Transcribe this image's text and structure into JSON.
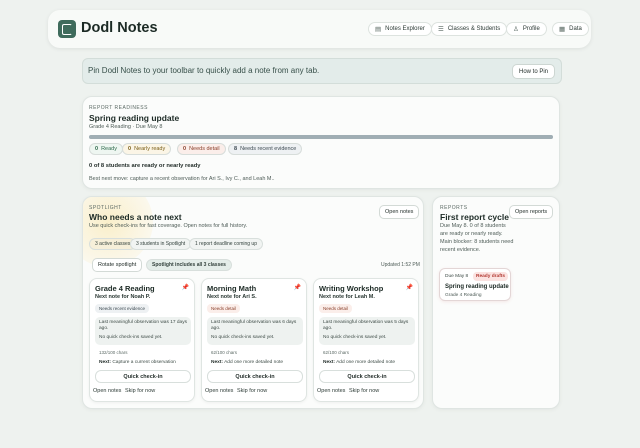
{
  "app": {
    "brand": "Dodl Notes",
    "nav": [
      {
        "label": "Notes Explorer",
        "icon": "note-icon"
      },
      {
        "label": "Classes & Students",
        "icon": "list-icon"
      },
      {
        "label": "Profile",
        "icon": "person-icon"
      },
      {
        "label": "Data",
        "icon": "database-icon"
      }
    ]
  },
  "pin_banner": {
    "text": "Pin Dodl Notes to your toolbar to quickly add a note from any tab.",
    "button": "How to Pin"
  },
  "readiness": {
    "kicker": "REPORT READINESS",
    "title": "Spring reading update",
    "subtitle": "Grade 4 Reading · Due May 8",
    "progress": 0,
    "pills": [
      {
        "count": "0",
        "label": "Ready",
        "bg": "#eef6f1",
        "color": "#2f6b4c"
      },
      {
        "count": "0",
        "label": "Nearly ready",
        "bg": "#fbf5e6",
        "color": "#7a5e17"
      },
      {
        "count": "0",
        "label": "Needs detail",
        "bg": "#fbeeea",
        "color": "#8a3f2a"
      },
      {
        "count": "8",
        "label": "Needs recent evidence",
        "bg": "#eef1f3",
        "color": "#3d4a52"
      }
    ],
    "summary": "0 of 8 students are ready or nearly ready",
    "next_move": "Best next move: capture a recent observation for Ari S., Ivy C., and Leah M.."
  },
  "spotlight": {
    "kicker": "SPOTLIGHT",
    "title": "Who needs a note next",
    "subtitle": "Use quick check-ins for fast coverage. Open notes for full history.",
    "open_notes": "Open notes",
    "chips": [
      "3 active classes",
      "3 students in Spotlight",
      "1 report deadline coming up"
    ],
    "rotate": "Rotate spotlight",
    "includes": "Spotlight includes all 3 classes",
    "updated": "Updated 1:52 PM",
    "classes": [
      {
        "title": "Grade 4 Reading",
        "next_note": "Next note for Noah P.",
        "tag": "Needs recent evidence",
        "tag_bg": "#eef1f3",
        "tag_color": "#3d4a52",
        "observation": "Last meaningful observation was 17 days ago.",
        "checkins": "No quick check-ins saved yet.",
        "chars": "132/100 chars",
        "next_label": "Next:",
        "next_text": "Capture a current observation",
        "quick": "Quick check-in",
        "open": "Open notes",
        "skip": "Skip for now"
      },
      {
        "title": "Morning Math",
        "next_note": "Next note for Ari S.",
        "tag": "Needs detail",
        "tag_bg": "#fbeeea",
        "tag_color": "#8a3f2a",
        "observation": "Last meaningful observation was 6 days ago.",
        "checkins": "No quick check-ins saved yet.",
        "chars": "62/100 chars",
        "next_label": "Next:",
        "next_text": "Add one more detailed note",
        "quick": "Quick check-in",
        "open": "Open notes",
        "skip": "Skip for now"
      },
      {
        "title": "Writing Workshop",
        "next_note": "Next note for Leah M.",
        "tag": "Needs detail",
        "tag_bg": "#fbeeea",
        "tag_color": "#8a3f2a",
        "observation": "Last meaningful observation was 5 days ago.",
        "checkins": "No quick check-ins saved yet.",
        "chars": "62/100 chars",
        "next_label": "Next:",
        "next_text": "Add one more detailed note",
        "quick": "Quick check-in",
        "open": "Open notes",
        "skip": "Skip for now"
      }
    ]
  },
  "reports": {
    "kicker": "REPORTS",
    "title": "First report cycle",
    "open": "Open reports",
    "desc": "Due May 8. 0 of 8 students are ready or nearly ready. Main blocker: 8 students need recent evidence.",
    "card": {
      "due": "Due May 8",
      "badge": "Ready drafts",
      "title": "Spring reading update",
      "sub": "Grade 4 Reading"
    }
  }
}
